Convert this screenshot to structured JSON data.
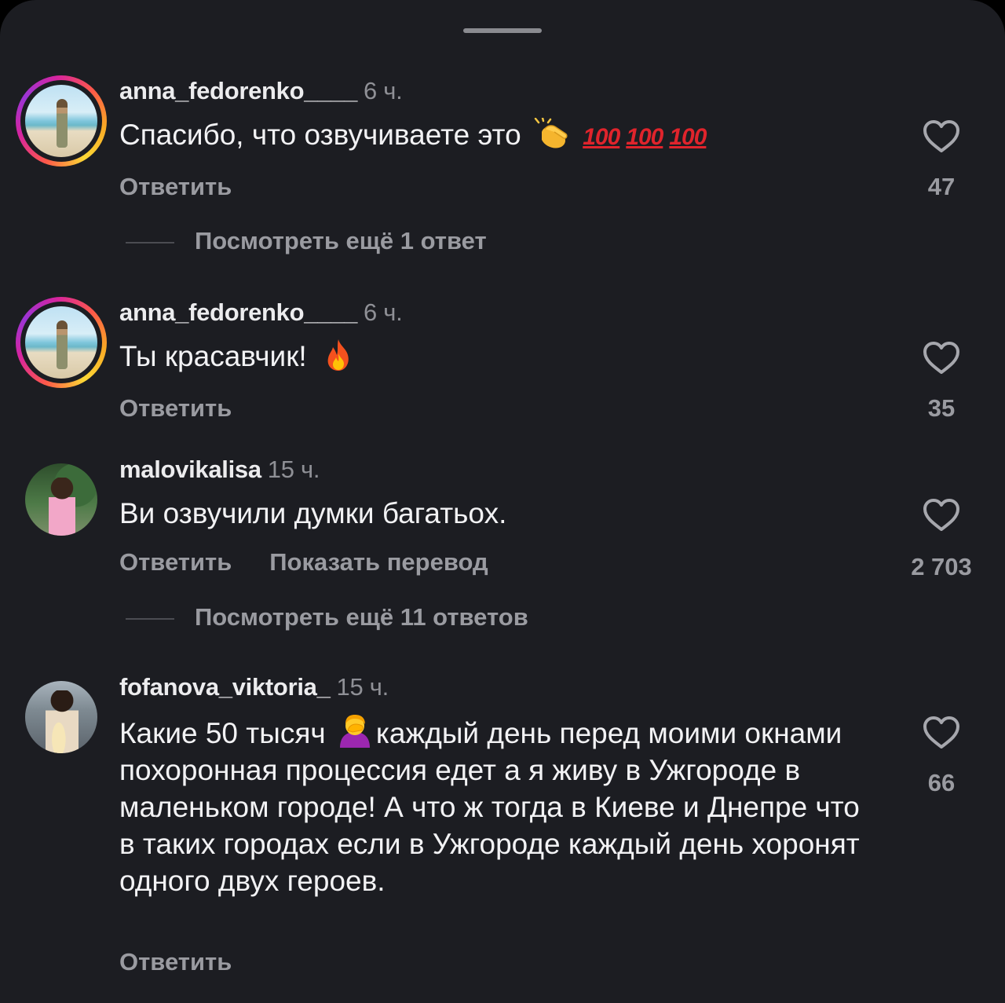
{
  "comments": [
    {
      "username": "anna_fedorenko____",
      "time": "6 ч.",
      "text": "Спасибо, что озвучиваете это",
      "emoji": [
        "clapping-hands",
        "hundred-points"
      ],
      "hundred_label": "100",
      "reply_label": "Ответить",
      "likes": "47",
      "view_more": "Посмотреть ещё 1 ответ"
    },
    {
      "username": "anna_fedorenko____",
      "time": "6 ч.",
      "text": "Ты красавчик!",
      "emoji": [
        "fire"
      ],
      "reply_label": "Ответить",
      "likes": "35"
    },
    {
      "username": "malovikalisa",
      "time": "15 ч.",
      "text": "Ви озвучили думки багатьох.",
      "reply_label": "Ответить",
      "translate_label": "Показать перевод",
      "likes": "2 703",
      "view_more": "Посмотреть ещё 11 ответов"
    },
    {
      "username": "fofanova_viktoria_",
      "time": "15 ч.",
      "text_before_emoji": "Какие 50 тысяч",
      "emoji": [
        "woman-facepalming"
      ],
      "text_after_emoji": "каждый день перед моими окнами похоронная процессия едет а я живу в Ужгороде в маленьком городе! А что ж тогда в Киеве и Днепре что в таких городах если в Ужгороде каждый день хоронят одного двух героев.",
      "reply_label": "Ответить",
      "likes": "66"
    }
  ],
  "colors": {
    "sheet_background": "#1c1d22",
    "primary_text": "#f2f2f4",
    "secondary_text": "#9a9ba1",
    "hundred_emoji": "#e0242c"
  }
}
